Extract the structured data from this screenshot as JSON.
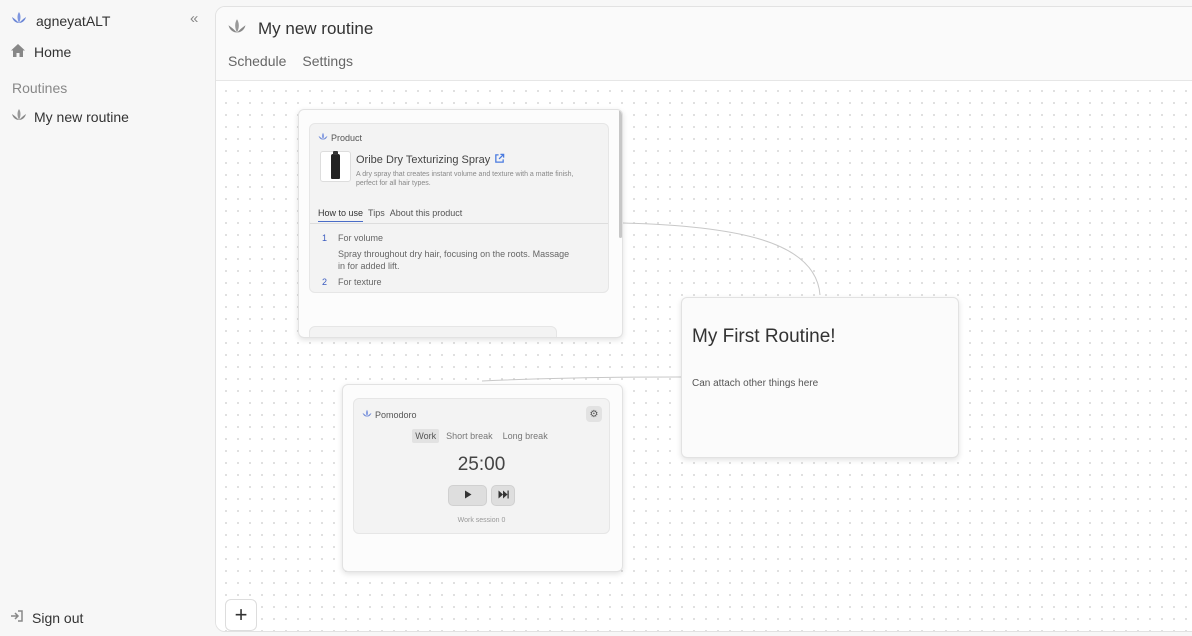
{
  "sidebar": {
    "brand": "agneyatALT",
    "home": "Home",
    "section": "Routines",
    "routine": "My new routine",
    "signout": "Sign out"
  },
  "header": {
    "title": "My new routine",
    "tabs": [
      "Schedule",
      "Settings"
    ]
  },
  "product_node": {
    "label": "Product",
    "name": "Oribe Dry Texturizing Spray",
    "description": "A dry spray that creates instant volume and texture with a matte finish, perfect for all hair types.",
    "tabs": [
      "How to use",
      "Tips",
      "About this product"
    ],
    "steps": [
      {
        "num": "1",
        "title": "For volume",
        "desc": "Spray throughout dry hair, focusing on the roots. Massage in for added lift."
      },
      {
        "num": "2",
        "title": "For texture"
      }
    ]
  },
  "pomodoro_node": {
    "label": "Pomodoro",
    "modes": [
      "Work",
      "Short break",
      "Long break"
    ],
    "time": "25:00",
    "session": "Work session 0"
  },
  "routine_node": {
    "title": "My First Routine!",
    "description": "Can attach other things here"
  },
  "colors": {
    "accent": "#6b86d6",
    "icon_gray": "#888888"
  },
  "icons": {
    "brand": "lotus-icon",
    "home": "home-icon",
    "collapse": "double-chevron-left-icon",
    "routine": "lotus-icon",
    "signout": "sign-out-icon",
    "external": "external-link-icon",
    "settings": "gear-icon",
    "play": "play-icon",
    "skip": "skip-forward-icon",
    "add": "plus-icon"
  }
}
